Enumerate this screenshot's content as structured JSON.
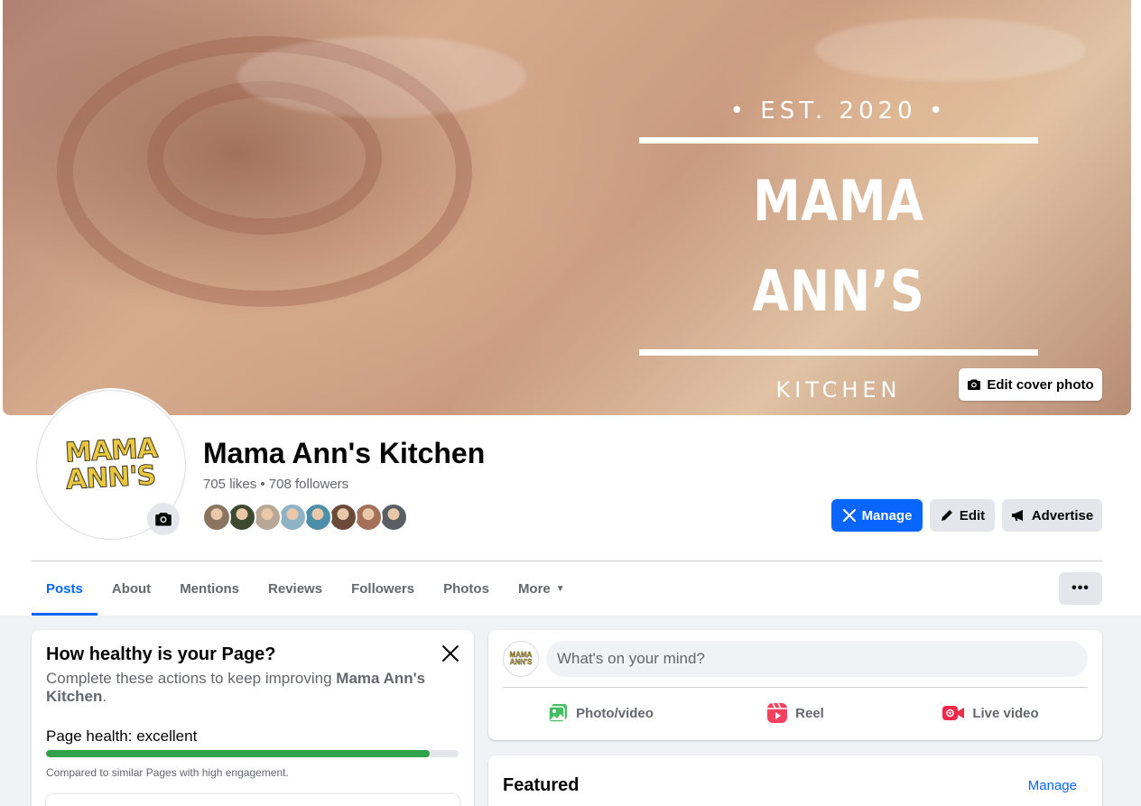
{
  "cover": {
    "est": "• EST. 2020 •",
    "title": "MAMA ANN’S",
    "subtitle": "KITCHEN",
    "edit_label": "Edit cover photo"
  },
  "profile": {
    "logo_line1": "MAMA",
    "logo_line2": "ANN'S",
    "name": "Mama Ann's Kitchen",
    "stats": "705 likes • 708 followers",
    "friend_colors": [
      "#8a7560",
      "#3d4a2f",
      "#b9a795",
      "#8fb3c4",
      "#4d8fa8",
      "#6b4a3a",
      "#a4705a",
      "#5a5f66"
    ]
  },
  "actions": {
    "manage": "Manage",
    "edit": "Edit",
    "advertise": "Advertise"
  },
  "tabs": [
    {
      "label": "Posts",
      "active": true
    },
    {
      "label": "About"
    },
    {
      "label": "Mentions"
    },
    {
      "label": "Reviews"
    },
    {
      "label": "Followers"
    },
    {
      "label": "Photos"
    },
    {
      "label": "More"
    }
  ],
  "tabs_more_button": "•••",
  "health": {
    "title": "How healthy is your Page?",
    "desc_prefix": "Complete these actions to keep improving ",
    "desc_name": "Mama Ann's Kitchen",
    "desc_suffix": ".",
    "label": "Page health: excellent",
    "progress": 0.93,
    "note": "Compared to similar Pages with high engagement."
  },
  "composer": {
    "avatar_text": "MAMA ANN'S",
    "placeholder": "What's on your mind?",
    "photo_video": "Photo/video",
    "reel": "Reel",
    "live_video": "Live video"
  },
  "featured": {
    "title": "Featured",
    "manage": "Manage"
  },
  "colors": {
    "accent": "#0866ff",
    "health_green": "#31a24c",
    "photo_green": "#45bd62",
    "reel_pink": "#f3425f",
    "live_red": "#f02849"
  }
}
